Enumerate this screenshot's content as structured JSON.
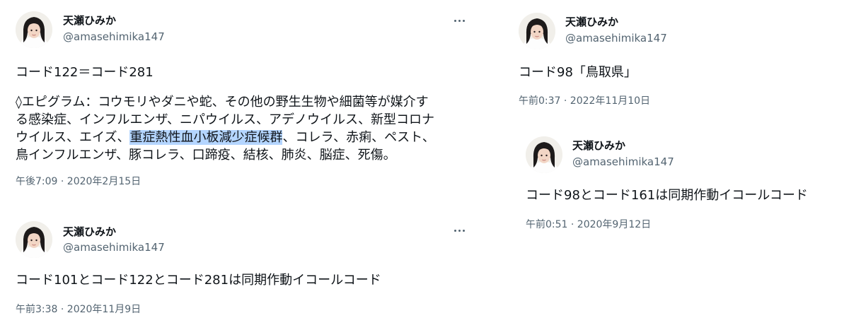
{
  "author": {
    "display_name": "天瀬ひみか",
    "handle": "@amasehimika147"
  },
  "tweets": [
    {
      "body_line1": "コード122＝コード281",
      "body_lines": [
        "◊エピグラム：コウモリやダニや蛇、その他の野生生物や細菌等が媒介す",
        "る感染症、インフルエンザ、ニパウイルス、アデノウイルス、新型コロナ"
      ],
      "line_before_highlight": "ウイルス、エイズ、",
      "highlighted": "重症熱性血小板減少症候群",
      "line_after_highlight": "、コレラ、赤痢、ペスト、",
      "body_last_line": "鳥インフルエンザ、豚コレラ、口蹄疫、結核、肺炎、脳症、死傷。",
      "timestamp": "午後7:09 · 2020年2月15日"
    },
    {
      "body": "コード101とコード122とコード281は同期作動イコールコード",
      "timestamp": "午前3:38 · 2020年11月9日"
    },
    {
      "body": "コード98「鳥取県」",
      "timestamp": "午前0:37 · 2022年11月10日"
    },
    {
      "body": "コード98とコード161は同期作動イコールコード",
      "timestamp": "午前0:51 · 2020年9月12日"
    }
  ],
  "icons": {
    "more": "more-horizontal-icon",
    "avatar": "profile-avatar-image"
  },
  "colors": {
    "text": "#0f1419",
    "secondary": "#536471",
    "highlight": "#b4d5ff"
  }
}
